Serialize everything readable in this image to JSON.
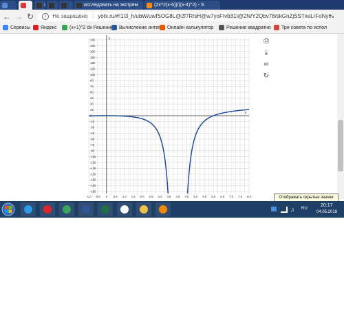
{
  "tabs": [
    {
      "icon_color": "#5b8bd6",
      "label": "",
      "icon": "doc-icon"
    },
    {
      "icon_color": "#e03a3e",
      "label": "",
      "icon": "a-icon",
      "active": true
    },
    {
      "icon_color": "#333333",
      "label": "3",
      "icon": "znanija-icon"
    },
    {
      "icon_color": "#333333",
      "label": "",
      "icon": "znanija-icon"
    },
    {
      "icon_color": "#333333",
      "label": "",
      "icon": "znanija-icon"
    },
    {
      "icon_color": "#333333",
      "label": "исследовать на экстрем",
      "icon": "znanija-icon"
    },
    {
      "icon_color": "#ff8a00",
      "label": "(2x^2(x-6))/((x-4)^2) - S",
      "icon": "fx-icon"
    }
  ],
  "address": {
    "insecure": "Не защищено",
    "url": "yotx.ru/#!1/3_h/ubW/uwfSOG8L@2f7R/sH@w7yoFIvb31t@2N/Y2Qbv78/skGnZjSSTxeLrFoNy6vNJd39k..."
  },
  "bookmarks": [
    {
      "label": "Сервисы",
      "color": "#4285f4"
    },
    {
      "label": "Яндекс",
      "color": "#e02020"
    },
    {
      "label": "(x+1)^2 dx Решение",
      "color": "#34a853"
    },
    {
      "label": "Вычисление интегр",
      "color": "#2b5797"
    },
    {
      "label": "Онлайн калькулятор",
      "color": "#e05a00"
    },
    {
      "label": "Решение квадратно",
      "color": "#555555"
    },
    {
      "label": "Три совета по испол",
      "color": "#d44638"
    }
  ],
  "chart_data": {
    "type": "line",
    "title": "",
    "xlabel": "x",
    "ylabel": "y",
    "xlim": [
      -1.0,
      6.0
    ],
    "ylim": [
      -200,
      200
    ],
    "grid": true,
    "x_ticks": [
      "-1.0",
      "-0.5",
      "0",
      "0.5",
      "1.0",
      "1.5",
      "2.0",
      "2.5",
      "3.0",
      "3.5",
      "4.0",
      "4.5",
      "5.0",
      "5.5",
      "6.0",
      "6.5",
      "7.0",
      "7.5",
      "8.0"
    ],
    "y_ticks": [
      "195",
      "180",
      "165",
      "150",
      "135",
      "120",
      "105",
      "90",
      "75",
      "60",
      "45",
      "30",
      "15",
      "0",
      "-15",
      "-30",
      "-45",
      "-60",
      "-75",
      "-90",
      "-105",
      "-120",
      "-135",
      "-150",
      "-165",
      "-180",
      "-195"
    ],
    "series": [
      {
        "name": "",
        "color": "#1f4e9c",
        "function": "2x^2(x-6)/(x-4)^2",
        "branches": [
          [
            -1.0,
            3.95
          ],
          [
            4.05,
            8.0
          ]
        ]
      }
    ]
  },
  "tools": [
    "printer-icon",
    "download-icon",
    "link-icon",
    "refresh-icon"
  ],
  "tooltip": "Отображать скрытые значки",
  "taskbar": {
    "apps": [
      {
        "icon": "ie-icon",
        "color": "#2a9be8"
      },
      {
        "icon": "opera-icon",
        "color": "#e0242f"
      },
      {
        "icon": "chrome-icon",
        "color": "#3aa757"
      },
      {
        "icon": "word-icon",
        "color": "#2b5797"
      },
      {
        "icon": "excel-icon",
        "color": "#1e7145"
      },
      {
        "icon": "flower-icon",
        "color": "#ffffff"
      },
      {
        "icon": "explorer-icon",
        "color": "#f3c244"
      },
      {
        "icon": "media-icon",
        "color": "#f18a00"
      }
    ],
    "lang": "RU",
    "time": "20:17",
    "date": "04.05.2018"
  }
}
